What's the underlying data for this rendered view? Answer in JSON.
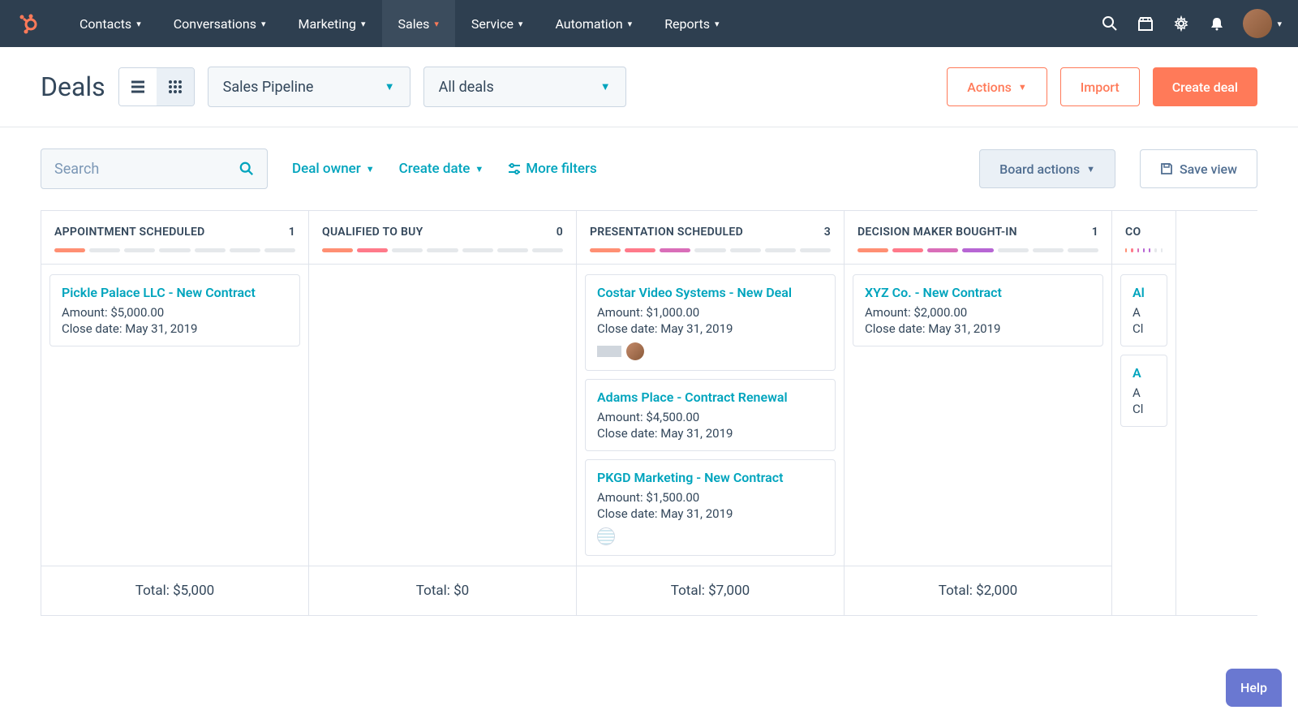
{
  "nav": {
    "items": [
      {
        "label": "Contacts"
      },
      {
        "label": "Conversations"
      },
      {
        "label": "Marketing"
      },
      {
        "label": "Sales",
        "active": true
      },
      {
        "label": "Service"
      },
      {
        "label": "Automation"
      },
      {
        "label": "Reports"
      }
    ]
  },
  "header": {
    "title": "Deals",
    "pipeline_select": "Sales Pipeline",
    "deals_select": "All deals",
    "actions_label": "Actions",
    "import_label": "Import",
    "create_label": "Create deal"
  },
  "filters": {
    "search_placeholder": "Search",
    "deal_owner": "Deal owner",
    "create_date": "Create date",
    "more_filters": "More filters",
    "board_actions": "Board actions",
    "save_view": "Save view"
  },
  "labels": {
    "amount": "Amount:",
    "close_date": "Close date:",
    "total": "Total:"
  },
  "columns": [
    {
      "name": "APPOINTMENT SCHEDULED",
      "count": 1,
      "progress": 1,
      "total": "$5,000",
      "cards": [
        {
          "title": "Pickle Palace LLC - New Contract",
          "amount": "$5,000.00",
          "close": "May 31, 2019"
        }
      ]
    },
    {
      "name": "QUALIFIED TO BUY",
      "count": 0,
      "progress": 2,
      "total": "$0",
      "cards": []
    },
    {
      "name": "PRESENTATION SCHEDULED",
      "count": 3,
      "progress": 3,
      "total": "$7,000",
      "cards": [
        {
          "title": "Costar Video Systems - New Deal",
          "amount": "$1,000.00",
          "close": "May 31, 2019",
          "avatar": true,
          "logo": true
        },
        {
          "title": "Adams Place - Contract Renewal",
          "amount": "$4,500.00",
          "close": "May 31, 2019"
        },
        {
          "title": "PKGD Marketing - New Contract",
          "amount": "$1,500.00",
          "close": "May 31, 2019",
          "globe": true
        }
      ]
    },
    {
      "name": "DECISION MAKER BOUGHT-IN",
      "count": 1,
      "progress": 4,
      "total": "$2,000",
      "cards": [
        {
          "title": "XYZ Co. - New Contract",
          "amount": "$2,000.00",
          "close": "May 31, 2019"
        }
      ]
    },
    {
      "name": "CO",
      "count": "",
      "progress": 5,
      "total": "",
      "cards": [
        {
          "title": "Al",
          "amount_prefix": "A",
          "close_prefix": "Cl"
        },
        {
          "title": "A",
          "amount_prefix": "A",
          "close_prefix": "Cl"
        }
      ],
      "truncated": true
    }
  ],
  "help_label": "Help"
}
